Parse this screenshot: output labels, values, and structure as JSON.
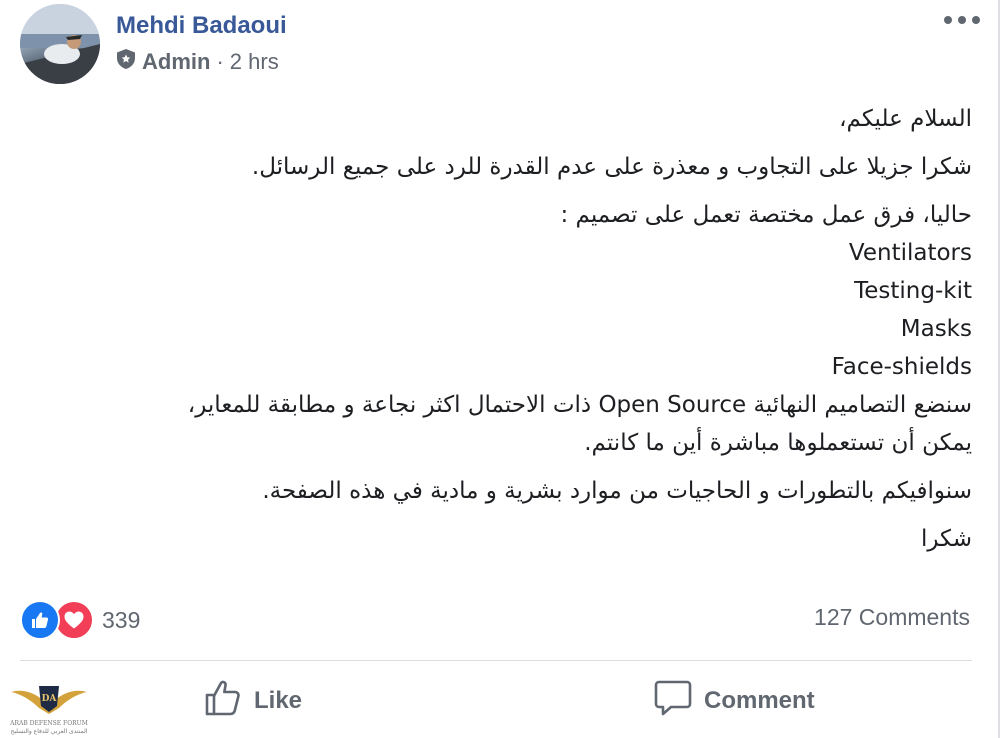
{
  "post": {
    "author": "Mehdi Badaoui",
    "role": "Admin",
    "separator": "·",
    "time": "2 hrs",
    "body": {
      "greeting": "السلام عليكم،",
      "thanks": "شكرا جزيلا على التجاوب و معذرة على عدم القدرة للرد على جميع الرسائل.",
      "intro": "حاليا، فرق عمل مختصة تعمل على تصميم :",
      "items": [
        "Ventilators",
        "Testing-kit",
        "Masks",
        "Face-shields"
      ],
      "open_source_line": "سنضع التصاميم النهائية Open Source ذات الاحتمال اكثر نجاعة و مطابقة للمعاير،",
      "use_line": "يمكن أن تستعملوها مباشرة أين ما كانتم.",
      "updates": "سنوافيكم بالتطورات و الحاجيات من موارد بشرية و مادية في هذه الصفحة.",
      "closing": "شكرا"
    }
  },
  "stats": {
    "reactions_count": "339",
    "comments_count": "127 Comments"
  },
  "actions": {
    "like_label": "Like",
    "comment_label": "Comment"
  },
  "watermark": {
    "logo_text": "DA",
    "line1": "ARAB DEFENSE FORUM",
    "line2": "المنتدى العربي للدفاع والتسليح"
  },
  "colors": {
    "author_link": "#385898",
    "muted": "#606770",
    "like_blue": "#1877f2",
    "love_red": "#f33e58"
  },
  "icons": [
    "shield-icon",
    "more-options-icon",
    "like-reaction-icon",
    "love-reaction-icon",
    "thumbs-up-icon",
    "comment-bubble-icon"
  ]
}
